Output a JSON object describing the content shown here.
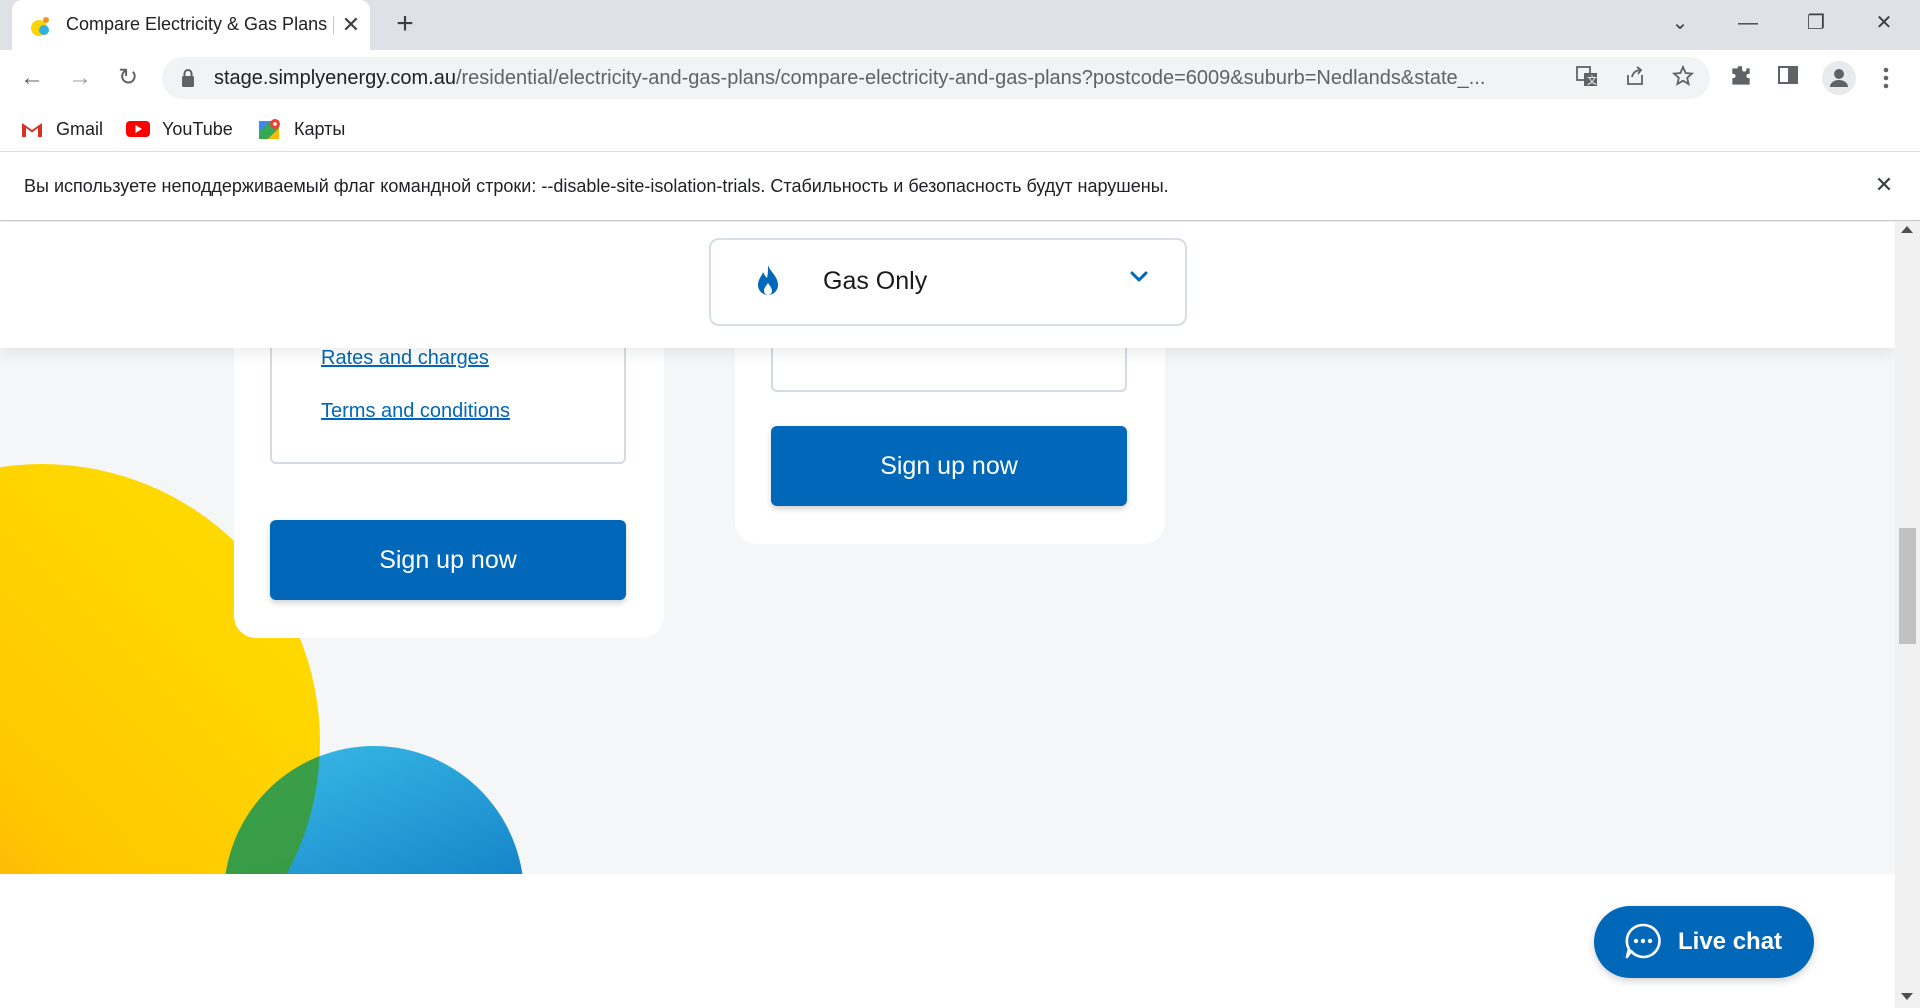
{
  "browser": {
    "tab": {
      "title": "Compare Electricity & Gas Plans |",
      "close_glyph": "✕"
    },
    "new_tab_glyph": "+",
    "window_controls": {
      "dropdown": "⌄",
      "minimize": "—",
      "restore": "❐",
      "close": "✕"
    },
    "nav": {
      "back": "←",
      "forward": "→",
      "reload": "↻"
    },
    "url": {
      "host": "stage.simplyenergy.com.au",
      "path": "/residential/electricity-and-gas-plans/compare-electricity-and-gas-plans?postcode=6009&suburb=Nedlands&state_..."
    },
    "bookmarks": [
      {
        "label": "Gmail",
        "icon": "gmail-icon"
      },
      {
        "label": "YouTube",
        "icon": "youtube-icon"
      },
      {
        "label": "Карты",
        "icon": "maps-icon"
      }
    ],
    "infobar": {
      "text": "Вы используете неподдерживаемый флаг командной строки: --disable-site-isolation-trials. Стабильность и безопасность будут нарушены.",
      "close_glyph": "✕"
    }
  },
  "page": {
    "plan_type_select": {
      "selected": "Gas Only",
      "icon": "flame-icon"
    },
    "card_left": {
      "links": [
        "Rates and charges",
        "Terms and conditions"
      ],
      "signup_label": "Sign up now"
    },
    "card_right": {
      "signup_label": "Sign up now"
    },
    "live_chat": {
      "label": "Live chat",
      "icon": "chat-bubble-icon"
    },
    "colors": {
      "brand_blue": "#0067b9",
      "sun_yellow": "#ffd200",
      "sun_orange": "#f7941d",
      "sky_blue": "#2eb0e0",
      "leaf_green": "#3a9c3a"
    }
  }
}
